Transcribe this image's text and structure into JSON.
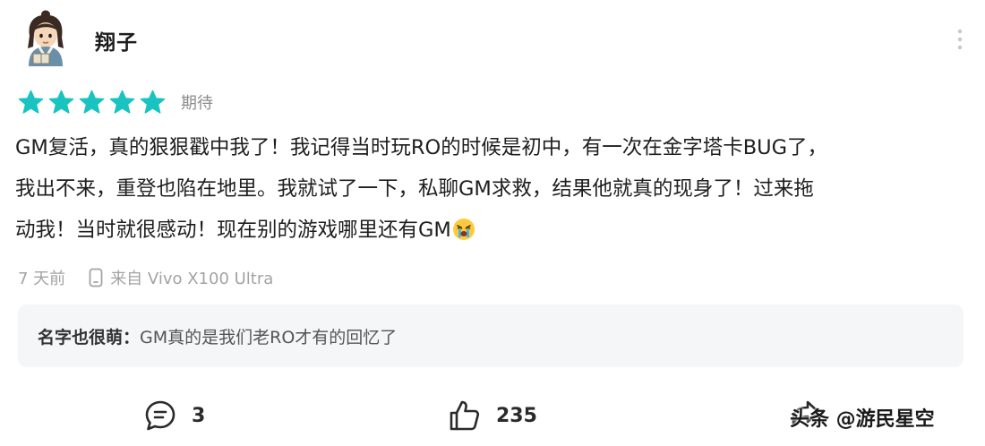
{
  "user": {
    "name": "翔子",
    "avatar_icon": "cartoon-avatar-icon"
  },
  "rating": {
    "stars": 5,
    "max": 5,
    "label": "期待",
    "star_color": "#19c3c0"
  },
  "review": {
    "lines": [
      "GM复活，真的狠狠戳中我了！我记得当时玩RO的时候是初中，有一次在金字塔卡BUG了，",
      "我出不来，重登也陷在地里。我就试了一下，私聊GM求救，结果他就真的现身了！过来拖",
      "动我！当时就很感动！现在别的游戏哪里还有GM"
    ],
    "trailing_emoji": "crying-face-emoji"
  },
  "meta": {
    "time": "7 天前",
    "device": "来自 Vivo X100 Ultra",
    "device_icon": "phone-icon"
  },
  "reply": {
    "author": "名字也很萌：",
    "text": "GM真的是我们老RO才有的回忆了"
  },
  "actions": {
    "comment_count": "3",
    "like_count": "235",
    "comment_icon": "comment-bubble-icon",
    "like_icon": "thumbs-up-icon",
    "share_icon": "share-icon"
  },
  "watermark": "头条 @游民星空",
  "colors": {
    "accent": "#19c3c0",
    "meta_text": "#a3a3a3",
    "reply_bg": "#f5f6f8"
  }
}
